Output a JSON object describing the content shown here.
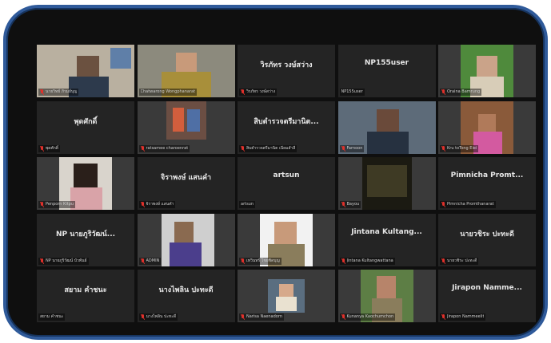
{
  "participants": [
    {
      "display": "",
      "label": "นายวิทย์ ภิรมย์บุญ",
      "video": true,
      "muted": true
    },
    {
      "display": "",
      "label": "Chatwarong Wongphanarat",
      "video": true,
      "muted": false
    },
    {
      "display": "วิรภัทร วงษ์สว่าง",
      "label": "วิรภัทร วงษ์สว่าง",
      "video": false,
      "muted": true
    },
    {
      "display": "NP155user",
      "label": "NP155user",
      "video": false,
      "muted": false
    },
    {
      "display": "",
      "label": "Oraina Bamrung",
      "video": true,
      "muted": true
    },
    {
      "display": "พุดศักดิ์",
      "label": "พุดศักดิ์",
      "video": false,
      "muted": true
    },
    {
      "display": "",
      "label": "ratsamee charoenrat",
      "video": true,
      "muted": true
    },
    {
      "display": "สิบตำรวจตรีมานิต...",
      "label": "สิบตำรวจตรีมานิต เนียมสำลี",
      "video": false,
      "muted": true
    },
    {
      "display": "",
      "label": "Farnoon",
      "video": true,
      "muted": true
    },
    {
      "display": "",
      "label": "Kru toTong Eiei",
      "video": true,
      "muted": true
    },
    {
      "display": "",
      "label": "Penporn Kitpu",
      "video": true,
      "muted": true
    },
    {
      "display": "จิราพงษ์ แสนคำ",
      "label": "จิราพงษ์ แสนคำ",
      "video": false,
      "muted": true
    },
    {
      "display": "artsun",
      "label": "artsun",
      "video": false,
      "muted": false
    },
    {
      "display": "",
      "label": "Bayou",
      "video": true,
      "muted": true
    },
    {
      "display": "Pimnicha Promt...",
      "label": "Pimnicha Promthanarat",
      "video": false,
      "muted": true
    },
    {
      "display": "NP นายภูริวัฒน์...",
      "label": "NP นายภูริวัฒน์ บัวพันธ์",
      "video": false,
      "muted": true
    },
    {
      "display": "",
      "label": "ADMIN",
      "video": true,
      "muted": true
    },
    {
      "display": "",
      "label": "เทวินทร์ ไชยชิดบุญ",
      "video": true,
      "muted": true
    },
    {
      "display": "Jintana Kultang...",
      "label": "Jintana Kultangwattana",
      "video": false,
      "muted": true
    },
    {
      "display": "นายวชิระ ปะทะดี",
      "label": "นายวชิระ ปะทะดี",
      "video": false,
      "muted": true
    },
    {
      "display": "สยาม คำชนะ",
      "label": "สยาม คำชนะ",
      "video": false,
      "muted": false
    },
    {
      "display": "นางไพลิน ปะทะดี",
      "label": "นางไพลิน ปะทะดี",
      "video": false,
      "muted": true
    },
    {
      "display": "",
      "label": "Narisa Naenadorn",
      "video": true,
      "muted": true
    },
    {
      "display": "",
      "label": "Kunanya Kaochumchon",
      "video": true,
      "muted": true
    },
    {
      "display": "Jirapon Namme...",
      "label": "Jirapon Nammeelit",
      "video": false,
      "muted": true
    }
  ],
  "colors": {
    "frame_border": "#2f5a9a",
    "tile_bg": "#242424",
    "muted_icon": "#e0312b"
  },
  "icons": {
    "muted": "microphone-muted-icon"
  }
}
